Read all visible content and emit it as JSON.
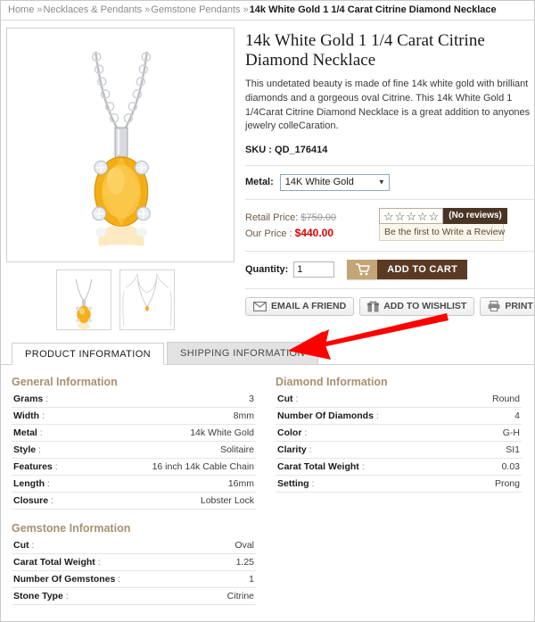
{
  "breadcrumb": {
    "separator": "»",
    "items": [
      {
        "label": "Home",
        "current": false
      },
      {
        "label": "Necklaces & Pendants",
        "current": false
      },
      {
        "label": "Gemstone Pendants",
        "current": false
      },
      {
        "label": "14k White Gold 1 1/4 Carat Citrine Diamond Necklace",
        "current": true
      }
    ]
  },
  "product": {
    "title": "14k White Gold 1 1/4 Carat Citrine Diamond Necklace",
    "description": "This undetated beauty is made of fine 14k white gold with brilliant diamonds and a gorgeous oval Citrine. This 14k White Gold 1 1/4Carat Citrine Diamond Necklace is a great addition to anyones jewelry colleCaration.",
    "sku_label": "SKU :",
    "sku_value": "QD_176414",
    "main_image_alt": "citrine-pendant-necklace",
    "thumbnails": [
      {
        "alt": "pendant-closeup-thumbnail"
      },
      {
        "alt": "necklace-on-model-thumbnail"
      }
    ]
  },
  "metal": {
    "label": "Metal:",
    "selected": "14K White Gold",
    "options": [
      "14K White Gold"
    ],
    "caret": "▼"
  },
  "pricing": {
    "retail_label": "Retail Price:",
    "retail_value": "$750.00",
    "our_label": "Our Price :",
    "our_value": "$440.00",
    "our_price_color": "#e00000"
  },
  "reviews": {
    "star_glyph": "☆",
    "star_count": 5,
    "filled": 0,
    "badge": "(No reviews)",
    "badge_color": "#4a3524",
    "write_review": "Be the first to Write a Review"
  },
  "purchase": {
    "qty_label": "Quantity:",
    "qty_value": "1",
    "add_to_cart": "ADD TO CART",
    "cart_icon": "shopping-cart-icon",
    "cart_icon_bg": "#c3a678",
    "cart_label_bg": "#5b3a24"
  },
  "actions": [
    {
      "label": "EMAIL A FRIEND",
      "icon": "envelope-icon"
    },
    {
      "label": "ADD TO WISHLIST",
      "icon": "gift-icon"
    },
    {
      "label": "PRINT",
      "icon": "printer-icon"
    }
  ],
  "tabs": [
    {
      "label": "PRODUCT INFORMATION",
      "active": true
    },
    {
      "label": "SHIPPING INFORMATION",
      "active": false
    }
  ],
  "annotation": {
    "type": "red-arrow",
    "color": "#ff0000",
    "points_to": "SHIPPING INFORMATION"
  },
  "specs": {
    "left": [
      {
        "heading": "General Information",
        "rows": [
          {
            "key": "Grams",
            "value": "3"
          },
          {
            "key": "Width",
            "value": "8mm"
          },
          {
            "key": "Metal",
            "value": "14k White Gold"
          },
          {
            "key": "Style",
            "value": "Solitaire"
          },
          {
            "key": "Features",
            "value": "16 inch 14k Cable Chain"
          },
          {
            "key": "Length",
            "value": "16mm"
          },
          {
            "key": "Closure",
            "value": "Lobster Lock"
          }
        ]
      },
      {
        "heading": "Gemstone Information",
        "rows": [
          {
            "key": "Cut",
            "value": "Oval"
          },
          {
            "key": "Carat Total Weight",
            "value": "1.25"
          },
          {
            "key": "Number Of Gemstones",
            "value": "1"
          },
          {
            "key": "Stone Type",
            "value": "Citrine"
          }
        ]
      }
    ],
    "right": [
      {
        "heading": "Diamond Information",
        "rows": [
          {
            "key": "Cut",
            "value": "Round"
          },
          {
            "key": "Number Of Diamonds",
            "value": "4"
          },
          {
            "key": "Color",
            "value": "G-H"
          },
          {
            "key": "Clarity",
            "value": "SI1"
          },
          {
            "key": "Carat Total Weight",
            "value": "0.03"
          },
          {
            "key": "Setting",
            "value": "Prong"
          }
        ]
      }
    ]
  }
}
